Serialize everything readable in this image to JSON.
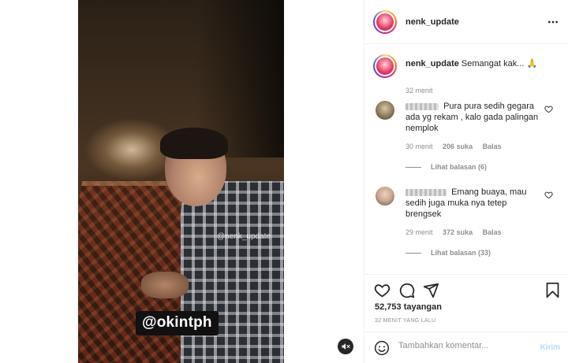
{
  "post": {
    "username": "nenk_update",
    "caption_user": "nenk_update",
    "caption_text": "Semangat kak... 🙏",
    "caption_time": "32 menit"
  },
  "media": {
    "watermark": "@nenk_update",
    "sticker": "@okintph",
    "mute_icon": "speaker-muted-icon"
  },
  "comments": [
    {
      "username": "d░░░░░░░",
      "text": "Pura pura sedih gegara ada yg rekam , kalo gada palingan nemplok",
      "time": "30 menit",
      "likes": "206 suka",
      "reply_label": "Balas",
      "view_replies": "Lihat balasan (6)"
    },
    {
      "username": "i░░░░░░░",
      "text": "Emang buaya, mau sedih juga muka nya tetep brengsek",
      "time": "29 menit",
      "likes": "372 suka",
      "reply_label": "Balas",
      "view_replies": "Lihat balasan (33)"
    }
  ],
  "stats": {
    "views": "52,753 tayangan",
    "time_ago": "32 MENIT YANG LALU"
  },
  "compose": {
    "placeholder": "Tambahkan komentar...",
    "post_label": "Kirim"
  },
  "colors": {
    "link_disabled": "#b3dbff",
    "secondary_text": "#8e8e8e",
    "primary_text": "#262626"
  }
}
